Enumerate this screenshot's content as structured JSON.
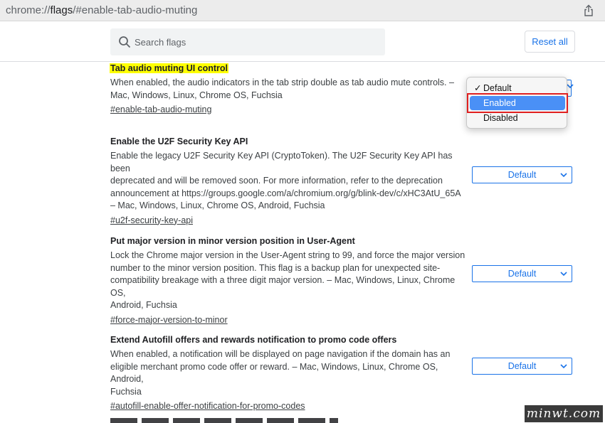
{
  "url": {
    "prefix": "chrome://",
    "bold": "flags",
    "rest": "/#enable-tab-audio-muting"
  },
  "search": {
    "placeholder": "Search flags",
    "value": ""
  },
  "reset_label": "Reset all",
  "flags": [
    {
      "title": "Tab audio muting UI control",
      "description": "When enabled, the audio indicators in the tab strip double as tab audio mute controls. –\nMac, Windows, Linux, Chrome OS, Fuchsia",
      "link": "#enable-tab-audio-muting",
      "highlighted": true
    },
    {
      "title": "Enable the U2F Security Key API",
      "description": "Enable the legacy U2F Security Key API (CryptoToken). The U2F Security Key API has been\ndeprecated and will be removed soon. For more information, refer to the deprecation\nannouncement at https://groups.google.com/a/chromium.org/g/blink-dev/c/xHC3AtU_65A\n– Mac, Windows, Linux, Chrome OS, Android, Fuchsia",
      "link": "#u2f-security-key-api",
      "select": "Default"
    },
    {
      "title": "Put major version in minor version position in User-Agent",
      "description": "Lock the Chrome major version in the User-Agent string to 99, and force the major version\nnumber to the minor version position. This flag is a backup plan for unexpected site-\ncompatibility breakage with a three digit major version. – Mac, Windows, Linux, Chrome OS,\nAndroid, Fuchsia",
      "link": "#force-major-version-to-minor",
      "select": "Default"
    },
    {
      "title": "Extend Autofill offers and rewards notification to promo code offers",
      "description": "When enabled, a notification will be displayed on page navigation if the domain has an\neligible merchant promo code offer or reward. – Mac, Windows, Linux, Chrome OS, Android,\nFuchsia",
      "link": "#autofill-enable-offer-notification-for-promo-codes",
      "select": "Default"
    }
  ],
  "dropdown": {
    "options": [
      "Default",
      "Enabled",
      "Disabled"
    ],
    "checked": "Default",
    "highlighted": "Enabled"
  },
  "watermark": "minwt.com",
  "colors": {
    "accent": "#1a73e8",
    "highlight": "#ffff00",
    "selection": "#4a90f6",
    "annotation": "#e02020"
  }
}
